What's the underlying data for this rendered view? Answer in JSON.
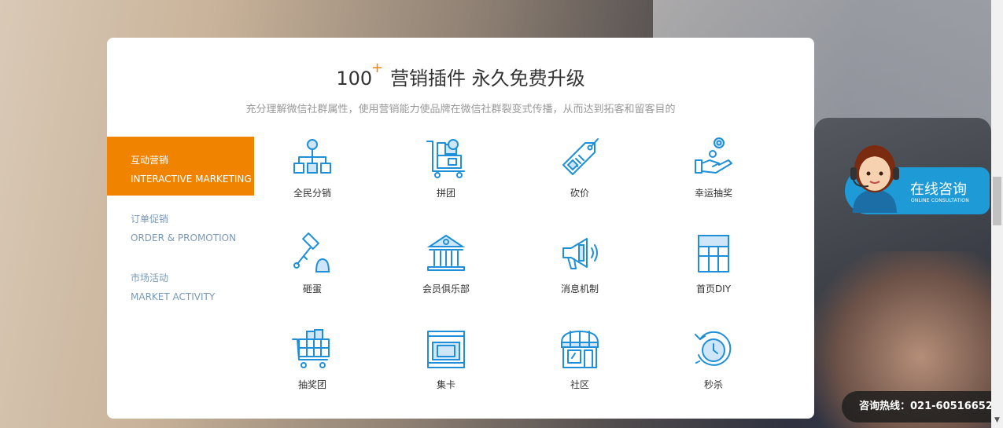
{
  "colors": {
    "accent": "#f08300",
    "icon": "#1e8fd8",
    "tab_inactive": "#7a99b8",
    "consult_bg": "#1e9bd7"
  },
  "header": {
    "number": "100",
    "plus": "+",
    "title": "营销插件 永久免费升级",
    "subtitle": "充分理解微信社群属性，使用营销能力使品牌在微信社群裂变式传播，从而达到拓客和留客目的"
  },
  "tabs": [
    {
      "cn": "互动营销",
      "en": "INTERACTIVE MARKETING",
      "active": true
    },
    {
      "cn": "订单促销",
      "en": "ORDER & PROMOTION",
      "active": false
    },
    {
      "cn": "市场活动",
      "en": "MARKET ACTIVITY",
      "active": false
    }
  ],
  "plugins": [
    {
      "label": "全民分销",
      "icon": "org-chart-icon"
    },
    {
      "label": "拼团",
      "icon": "cart-group-icon"
    },
    {
      "label": "砍价",
      "icon": "price-tag-icon"
    },
    {
      "label": "幸运抽奖",
      "icon": "hand-coin-icon"
    },
    {
      "label": "砸蛋",
      "icon": "hammer-egg-icon"
    },
    {
      "label": "会员俱乐部",
      "icon": "club-building-icon"
    },
    {
      "label": "消息机制",
      "icon": "megaphone-icon"
    },
    {
      "label": "首页DIY",
      "icon": "grid-layout-icon"
    },
    {
      "label": "抽奖团",
      "icon": "lottery-cart-icon"
    },
    {
      "label": "集卡",
      "icon": "card-collect-icon"
    },
    {
      "label": "社区",
      "icon": "shop-front-icon"
    },
    {
      "label": "秒杀",
      "icon": "stopwatch-icon"
    }
  ],
  "consult": {
    "title": "在线咨询",
    "subtitle": "ONLINE CONSULTATION"
  },
  "hotline": {
    "text": "咨询热线：021-60516652"
  },
  "scrollbar": {
    "arrow": "▼"
  }
}
